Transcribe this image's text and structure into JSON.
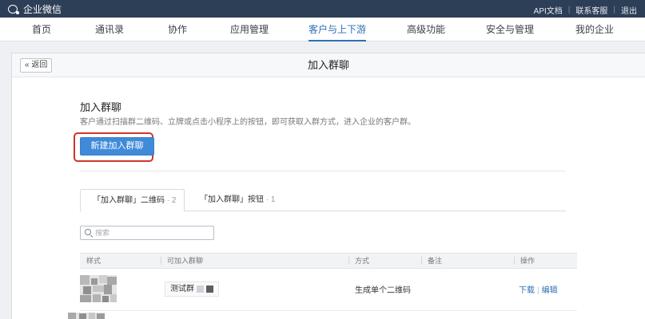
{
  "app": {
    "name": "企业微信"
  },
  "top_links": [
    "API文档",
    "联系客服",
    "退出"
  ],
  "nav": {
    "items": [
      "首页",
      "通讯录",
      "协作",
      "应用管理",
      "客户与上下游",
      "高级功能",
      "安全与管理",
      "我的企业"
    ],
    "active": "客户与上下游"
  },
  "panel": {
    "back_label": "« 返回",
    "title": "加入群聊"
  },
  "section": {
    "title": "加入群聊",
    "description": "客户通过扫描群二维码、立牌或点击小程序上的按钮，即可获取入群方式，进入企业的客户群。",
    "new_button": "新建加入群聊"
  },
  "tabs": [
    {
      "label": "「加入群聊」二维码",
      "count": "· 2",
      "active": true
    },
    {
      "label": "「加入群聊」按钮",
      "count": "· 1",
      "active": false
    }
  ],
  "search": {
    "placeholder": "搜索"
  },
  "table": {
    "columns": [
      "样式",
      "可加入群聊",
      "方式",
      "备注",
      "操作"
    ],
    "rows": [
      {
        "group": "测试群",
        "method": "生成单个二维码",
        "note": "",
        "actions": [
          "下载",
          "编辑"
        ]
      }
    ]
  },
  "colors": {
    "topbar": "#2d3e57",
    "accent": "#2f6fb3",
    "primary_button": "#3f8ad9",
    "highlight": "#d0342c"
  }
}
